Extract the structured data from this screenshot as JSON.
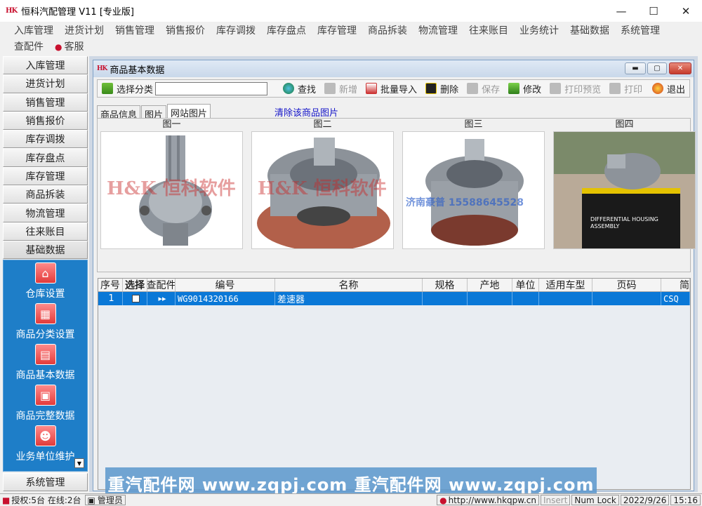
{
  "window": {
    "title": "恒科汽配管理 V11 [专业版]",
    "logo": "HK",
    "min": "—",
    "max": "☐",
    "close": "✕"
  },
  "menu": {
    "row1": [
      "入库管理",
      "进货计划",
      "销售管理",
      "销售报价",
      "库存调拨",
      "库存盘点",
      "库存管理",
      "商品拆装",
      "物流管理",
      "往来账目",
      "业务统计",
      "基础数据",
      "系统管理"
    ],
    "row2": [
      "查配件",
      "客服"
    ]
  },
  "nav": {
    "items": [
      "入库管理",
      "进货计划",
      "销售管理",
      "销售报价",
      "库存调拨",
      "库存盘点",
      "库存管理",
      "商品拆装",
      "物流管理",
      "往来账目",
      "基础数据"
    ],
    "sub": [
      {
        "label": "仓库设置",
        "icon": "warehouse-icon",
        "glyph": "⌂"
      },
      {
        "label": "商品分类设置",
        "icon": "category-icon",
        "glyph": "▦"
      },
      {
        "label": "商品基本数据",
        "icon": "document-icon",
        "glyph": "▤"
      },
      {
        "label": "商品完整数据",
        "icon": "documents-icon",
        "glyph": "▣"
      },
      {
        "label": "业务单位维护",
        "icon": "person-icon",
        "glyph": "☻"
      }
    ],
    "bottom": "系统管理"
  },
  "child": {
    "title": "商品基本数据",
    "logo": "HK"
  },
  "toolbar": {
    "category": "选择分类",
    "find": "查找",
    "add": "新增",
    "batch": "批量导入",
    "delete": "删除",
    "save": "保存",
    "edit": "修改",
    "preview": "打印预览",
    "print": "打印",
    "exit": "退出"
  },
  "tabs": [
    "商品信息",
    "图片",
    "网站图片"
  ],
  "clear_link": "清除该商品图片",
  "images": [
    {
      "caption": "图一",
      "wm": "H&K 恒科软件"
    },
    {
      "caption": "图二",
      "wm": "H&K 恒科软件"
    },
    {
      "caption": "图三",
      "wm": "济南豪普 15588645528"
    },
    {
      "caption": "图四",
      "wm": "DIFFERENTIAL HOUSING ASSEMBLY"
    }
  ],
  "grid": {
    "headers": [
      "序号",
      "选择",
      "查配件",
      "编号",
      "名称",
      "规格",
      "产地",
      "单位",
      "适用车型",
      "页码",
      "简"
    ],
    "rows": [
      {
        "no": "1",
        "code": "WG9014320166",
        "name": "差速器",
        "extra": "CSQ"
      }
    ]
  },
  "status": {
    "auth": "授权:5台 在线:2台",
    "user": "管理员",
    "url": "http://www.hkqpw.cn",
    "ins": "Insert",
    "num": "Num Lock",
    "date": "2022/9/26",
    "time": "15:16"
  },
  "watermark": "重汽配件网 www.zqpj.com 重汽配件网 www.zqpj.com",
  "colors": {
    "accent": "#0a78d7",
    "nav_panel": "#1e7ec8",
    "brand_red": "#c8102e"
  }
}
